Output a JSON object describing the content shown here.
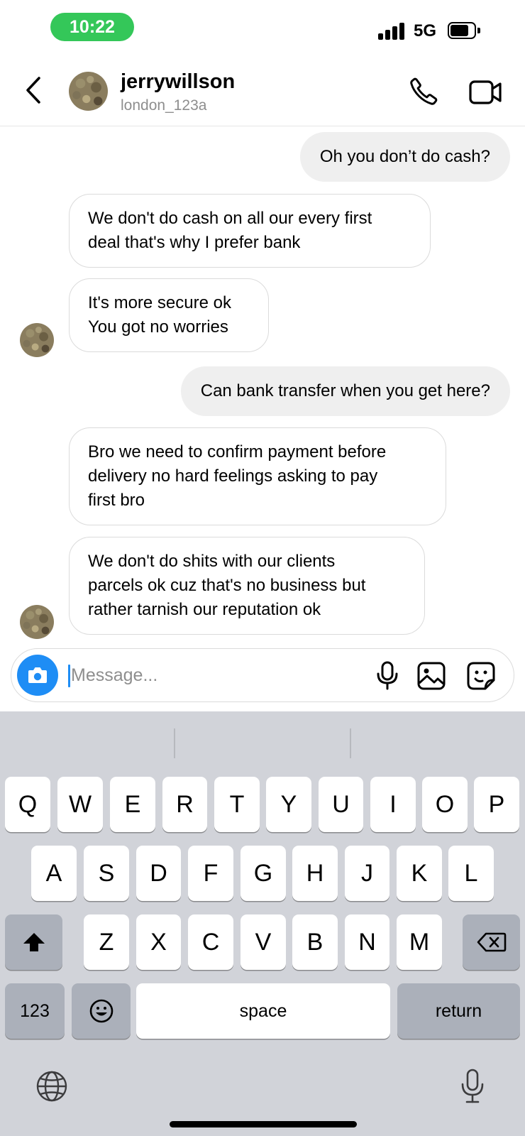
{
  "status_bar": {
    "time": "10:22",
    "network": "5G"
  },
  "header": {
    "username": "jerrywillson",
    "subname": "london_123a"
  },
  "messages": [
    {
      "from": "me",
      "lines": [
        "Oh you don’t do cash?"
      ]
    },
    {
      "from": "them",
      "lines": [
        "We don't do cash on all our every first",
        "deal that's why I prefer bank"
      ]
    },
    {
      "from": "them",
      "lines": [
        "It's more secure ok",
        "You got no worries"
      ]
    },
    {
      "from": "me",
      "lines": [
        "Can bank transfer when you get here?"
      ]
    },
    {
      "from": "them",
      "lines": [
        "Bro we need to confirm payment before",
        "delivery no hard feelings asking to pay",
        "first bro"
      ]
    },
    {
      "from": "them",
      "lines": [
        "We don't do shits with our clients",
        "parcels ok cuz that's no business but",
        "rather tarnish our reputation ok"
      ]
    }
  ],
  "composer": {
    "placeholder": "Message...",
    "value": ""
  },
  "keyboard": {
    "row1": [
      "Q",
      "W",
      "E",
      "R",
      "T",
      "Y",
      "U",
      "I",
      "O",
      "P"
    ],
    "row2": [
      "A",
      "S",
      "D",
      "F",
      "G",
      "H",
      "J",
      "K",
      "L"
    ],
    "row3": [
      "Z",
      "X",
      "C",
      "V",
      "B",
      "N",
      "M"
    ],
    "numbers_label": "123",
    "space_label": "space",
    "return_label": "return"
  },
  "colors": {
    "accent": "#1e8df5",
    "time_pill": "#34c759",
    "sent_bubble": "#efefef",
    "keyboard_bg": "#d1d3d9"
  }
}
